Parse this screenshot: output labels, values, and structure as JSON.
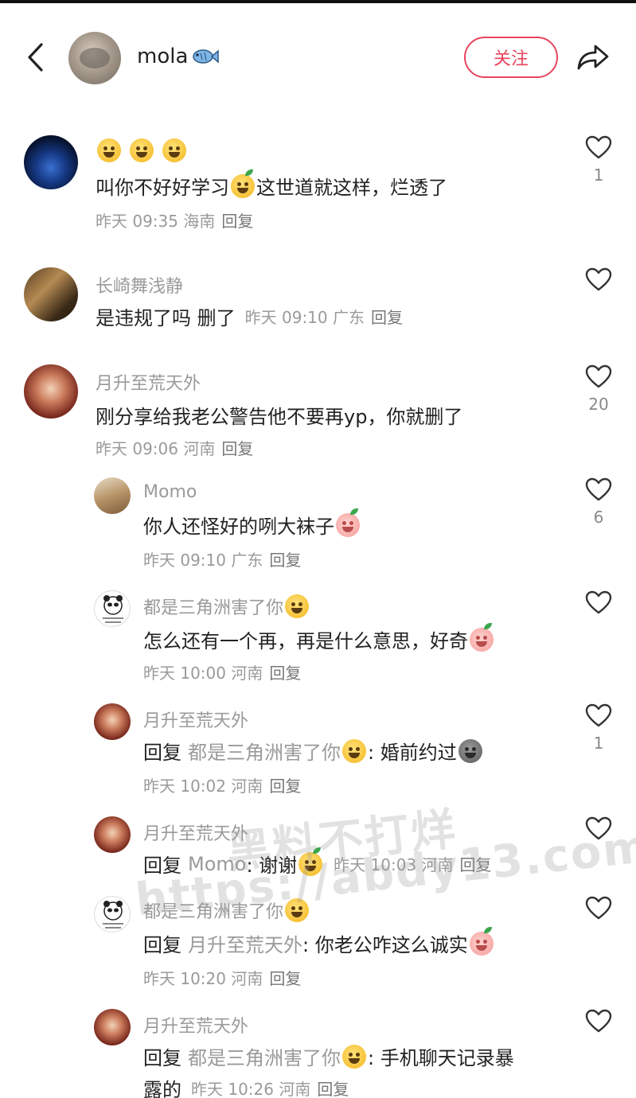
{
  "header": {
    "name": "mola",
    "follow_label": "关注"
  },
  "comments": [
    {
      "name_emoji_count": 3,
      "text_before": "叫你不好好学习",
      "text_after": "这世道就这样，烂透了",
      "time": "昨天 09:35",
      "region": "海南",
      "reply_label": "回复",
      "likes": "1"
    },
    {
      "name": "长崎舞浅静",
      "text": "是违规了吗 删了",
      "time": "昨天 09:10",
      "region": "广东",
      "reply_label": "回复",
      "likes": ""
    },
    {
      "name": "月升至荒天外",
      "text": "刚分享给我老公警告他不要再yp，你就删了",
      "time": "昨天 09:06",
      "region": "河南",
      "reply_label": "回复",
      "likes": "20"
    }
  ],
  "replies": [
    {
      "name": "Momo",
      "text": "你人还怪好的咧大袜子",
      "time": "昨天 09:10",
      "region": "广东",
      "reply_label": "回复",
      "likes": "6"
    },
    {
      "name": "都是三角洲害了你",
      "text": "怎么还有一个再，再是什么意思，好奇",
      "time": "昨天 10:00",
      "region": "河南",
      "reply_label": "回复",
      "likes": ""
    },
    {
      "name": "月升至荒天外",
      "prefix": "回复",
      "target": "都是三角洲害了你",
      "text": ": 婚前约过",
      "time": "昨天 10:02",
      "region": "河南",
      "reply_label": "回复",
      "likes": "1"
    },
    {
      "name": "月升至荒天外",
      "prefix": "回复",
      "target": "Momo",
      "text": ": 谢谢",
      "time": "昨天 10:03",
      "region": "河南",
      "reply_label": "回复",
      "likes": ""
    },
    {
      "name": "都是三角洲害了你",
      "prefix": "回复",
      "target": "月升至荒天外",
      "text": ": 你老公咋这么诚实",
      "time": "昨天 10:20",
      "region": "河南",
      "reply_label": "回复",
      "likes": ""
    },
    {
      "name": "月升至荒天外",
      "prefix": "回复",
      "target": "都是三角洲害了你",
      "text": ": 手机聊天记录暴",
      "text_line2": "露的",
      "time": "昨天 10:26",
      "region": "河南",
      "reply_label": "回复",
      "likes": ""
    }
  ],
  "watermark": {
    "line1": "黑料不打烊",
    "line2": "https://abdy13.com"
  },
  "colors": {
    "accent": "#e8455d",
    "meta_gray": "#9a9a9a"
  },
  "icons": [
    "back-chevron-icon",
    "fish-icon",
    "share-arrow-icon",
    "heart-outline-icon"
  ]
}
